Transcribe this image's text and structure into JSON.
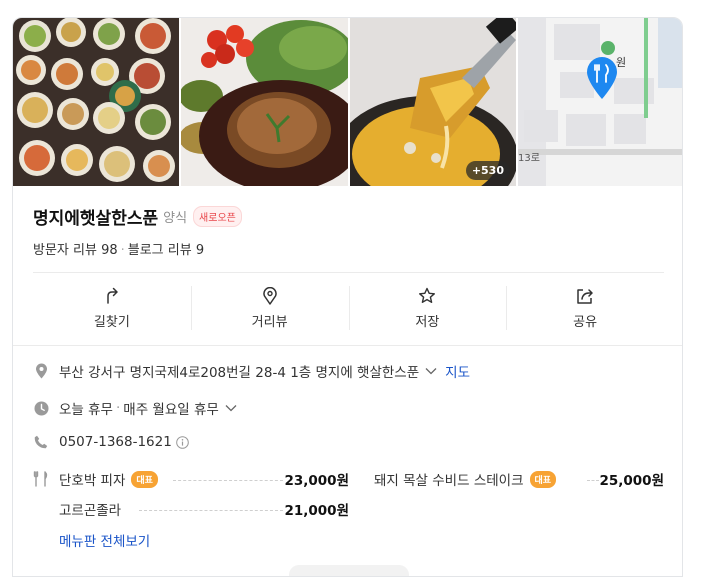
{
  "photos": {
    "count_badge": "+530",
    "map_pin_label": "원",
    "map_road_label": "13로"
  },
  "place": {
    "name": "명지에햇살한스푼",
    "category": "양식",
    "badge": "새로오픈",
    "visitor_reviews": "방문자 리뷰 98",
    "blog_reviews": "블로그 리뷰 9"
  },
  "actions": [
    {
      "label": "길찾기",
      "icon": "directions-icon"
    },
    {
      "label": "거리뷰",
      "icon": "streetview-icon"
    },
    {
      "label": "저장",
      "icon": "star-icon"
    },
    {
      "label": "공유",
      "icon": "share-icon"
    }
  ],
  "info": {
    "address": "부산 강서구 명지국제4로208번길 28-4 1층 명지에 햇살한스푼",
    "map_link": "지도",
    "hours_today": "오늘 휴무",
    "hours_note": "매주 월요일 휴무",
    "phone": "0507-1368-1621"
  },
  "menu": {
    "items": [
      {
        "name": "단호박 피자",
        "badge": "대표",
        "price": "23,000원"
      },
      {
        "name": "돼지 목살 수비드 스테이크",
        "badge": "대표",
        "price": "25,000원"
      },
      {
        "name": "고르곤졸라",
        "badge": "",
        "price": "21,000원"
      }
    ],
    "view_all": "메뉴판 전체보기"
  },
  "colors": {
    "link": "#1a54c8",
    "badge_new": "#e8464a",
    "badge_menu": "#f7a334",
    "map_pin": "#1e88f0"
  }
}
